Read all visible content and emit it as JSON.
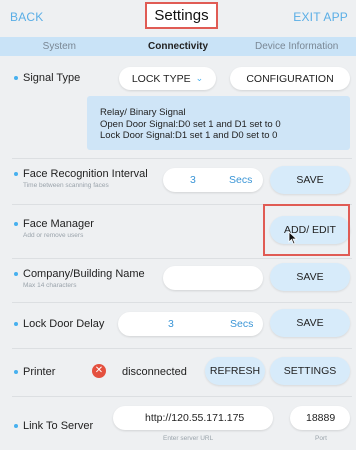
{
  "header": {
    "back_label": "BACK",
    "title": "Settings",
    "exit_label": "EXIT APP"
  },
  "tabs": [
    {
      "label": "System",
      "active": false
    },
    {
      "label": "Connectivity",
      "active": true
    },
    {
      "label": "Device Information",
      "active": false
    }
  ],
  "signal_type": {
    "label": "Signal Type",
    "dropdown_value": "LOCK TYPE",
    "configuration_label": "CONFIGURATION",
    "info_lines": [
      "Relay/ Binary Signal",
      "Open Door Signal:D0 set 1 and D1 set to 0",
      "Lock Door Signal:D1 set 1 and D0 set to 0"
    ]
  },
  "face_recognition_interval": {
    "label": "Face Recognition Interval",
    "sublabel": "Time between scanning faces",
    "value": "3",
    "unit": "Secs",
    "save_label": "SAVE"
  },
  "face_manager": {
    "label": "Face Manager",
    "sublabel": "Add or remove users",
    "button_label": "ADD/ EDIT"
  },
  "company_name": {
    "label": "Company/Building Name",
    "sublabel": "Max 14 characters",
    "value": "",
    "save_label": "SAVE"
  },
  "lock_door_delay": {
    "label": "Lock Door Delay",
    "value": "3",
    "unit": "Secs",
    "save_label": "SAVE"
  },
  "printer": {
    "label": "Printer",
    "status_icon": "error-x-icon",
    "status": "disconnected",
    "refresh_label": "REFRESH",
    "settings_label": "SETTINGS"
  },
  "link_to_server": {
    "label": "Link To Server",
    "url": "http://120.55.171.175",
    "url_caption": "Enter server URL",
    "port": "18889",
    "port_caption": "Port"
  },
  "colors": {
    "accent": "#46b0ef",
    "highlight_border": "#e05b54",
    "button_bg": "#d7ebfa",
    "error": "#e4503f"
  }
}
